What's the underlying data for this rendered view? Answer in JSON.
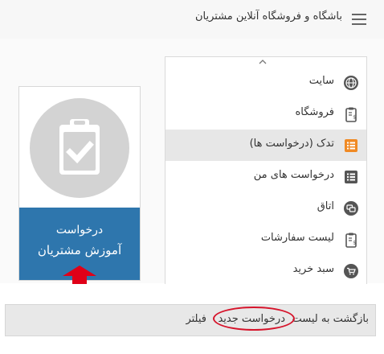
{
  "header": {
    "title": "باشگاه و فروشگاه آنلاین مشتریان",
    "menu_icon": "hamburger-icon"
  },
  "sidebar": {
    "scroll_icon": "caret-up-icon",
    "items": [
      {
        "label": "سایت",
        "icon": "globe-icon"
      },
      {
        "label": "فروشگاه",
        "icon": "clipboard-dollar-icon"
      },
      {
        "label": "تدک (درخواست ها)",
        "icon": "list-icon",
        "active": true
      },
      {
        "label": "درخواست های من",
        "icon": "list-icon"
      },
      {
        "label": "اتاق",
        "icon": "chat-icon"
      },
      {
        "label": "لیست سفارشات",
        "icon": "clipboard-dollar-icon"
      },
      {
        "label": "سبد خرید",
        "icon": "cart-icon"
      }
    ]
  },
  "card": {
    "icon": "clipboard-check-icon",
    "line1": "درخواست",
    "line2": "آموزش مشتریان",
    "accent": "#2e76ad"
  },
  "annotation": {
    "arrow_color": "#e00018",
    "ellipse_color": "#d6142b"
  },
  "bottom_bar": {
    "back": "بازگشت به لیست",
    "new_request": "درخواست جدید",
    "filter": "فیلتر"
  },
  "colors": {
    "active_icon": "#f08a24",
    "icon_dark": "#555555"
  }
}
